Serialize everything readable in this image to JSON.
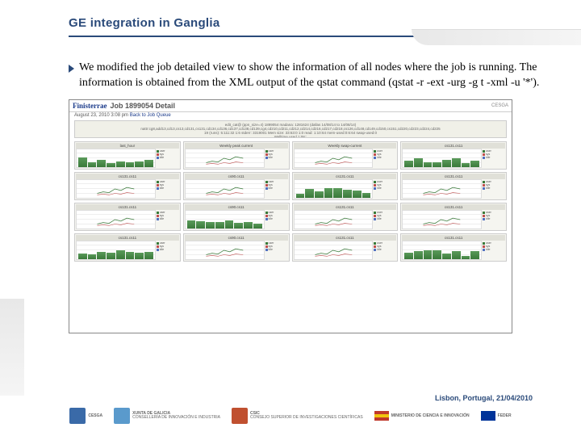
{
  "title": "GE integration in Ganglia",
  "body_text": "We modified the job detailed view to show the information of all nodes where the job is running. The information is obtained from the XML output of the qstat command (qstat -r -ext -urg -g t -xml -u '*').",
  "screenshot": {
    "brand": "Finisterrae",
    "page_title": "Job 1899054 Detail",
    "timestamp": "August 23, 2010 3:08 pm",
    "back_link": "Back to Job Queue",
    "right_logo": "CESGA",
    "info_lines": [
      "edit_cat@ (ppn_size=4) 1899054 madana: 1281624 (dallas 14/08/14 to 14/08/14)",
      "nattr:cg8,add13,cd13,cs13,cd131,cs131,cd134,cd136,cd137,cd138,cd139,cg4,cd210,cd211,cd212,cd214,cd216,cd217,cd218,cs126,cd148,cd149,cd150,cs151,cd220,cd223,cd224,cd225",
      "19 (runs): 5:111:32  1:6 stderr: 3319001  Mem size: 33:63:0  1:0 read: 1:10:64  mem-used:0:6:64  swap-used:0",
      "Walltime used 1:08::"
    ],
    "graph_panels": [
      {
        "title": "last_hour",
        "label": "cs90.cs11"
      },
      {
        "title": "Weekly peak current",
        "label": "cs131.cs11"
      },
      {
        "title": "Weekly swap-current",
        "label": "cs131.cs11"
      },
      {
        "title": "cs131.cs11",
        "label": ""
      },
      {
        "title": "cs131.cs11",
        "label": ""
      },
      {
        "title": "cs90.cs11",
        "label": ""
      },
      {
        "title": "cs131.cs11",
        "label": ""
      },
      {
        "title": "cs131.cs11",
        "label": ""
      },
      {
        "title": "cs131.cs11",
        "label": ""
      },
      {
        "title": "cs90.cs11",
        "label": ""
      },
      {
        "title": "cs131.cs11",
        "label": ""
      },
      {
        "title": "cs131.cs11",
        "label": ""
      },
      {
        "title": "cs131.cs11",
        "label": ""
      },
      {
        "title": "cs90.cs11",
        "label": ""
      },
      {
        "title": "cs131.cs11",
        "label": ""
      },
      {
        "title": "cs131.cs11",
        "label": ""
      }
    ]
  },
  "footer": {
    "location": "Lisbon, Portugal, 21/04/2010",
    "logos": [
      {
        "name": "CESGA",
        "sub": ""
      },
      {
        "name": "XUNTA DE GALICIA",
        "sub": "CONSELLERÍA DE INNOVACIÓN E INDUSTRIA"
      },
      {
        "name": "CSIC",
        "sub": "CONSEJO SUPERIOR DE INVESTIGACIONES CIENTÍFICAS"
      },
      {
        "name": "",
        "sub": "MINISTERIO DE CIENCIA E INNOVACIÓN"
      },
      {
        "name": "FEDER",
        "sub": ""
      }
    ]
  }
}
